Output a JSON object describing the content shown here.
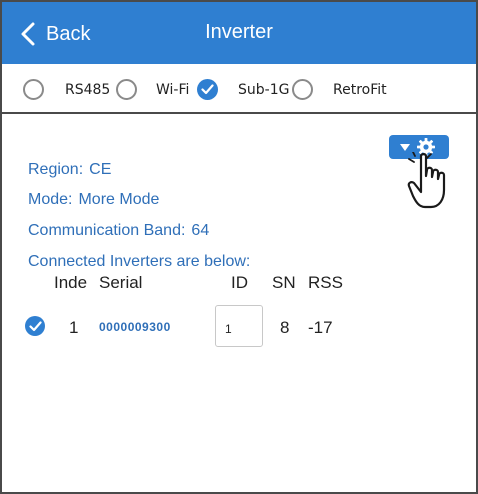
{
  "header": {
    "back_label": "Back",
    "title": "Inverter",
    "color": "#2f7fd1"
  },
  "modes": [
    {
      "label": "RS485",
      "selected": false
    },
    {
      "label": "Wi-Fi",
      "selected": false
    },
    {
      "label": "Sub-1G",
      "selected": true
    },
    {
      "label": "RetroFit",
      "selected": false
    }
  ],
  "info": {
    "region_label": "Region:",
    "region_value": "CE",
    "mode_label": "Mode:",
    "mode_value": "More Mode",
    "band_label": "Communication Band:",
    "band_value": "64",
    "connected_label": "Connected Inverters are below:"
  },
  "table": {
    "headers": [
      "Inde",
      "Serial",
      "ID",
      "SN",
      "RSS"
    ],
    "rows": [
      {
        "checked": true,
        "index": "1",
        "serial": "0000009300",
        "id": "1",
        "sn": "8",
        "rss": "-17"
      }
    ]
  },
  "icons": {
    "back": "chevron-left-icon",
    "settings": "gear-icon",
    "dropdown": "triangle-down-icon",
    "pointer": "hand-pointer-icon",
    "check": "check-icon"
  },
  "accent_color": "#2f7fd1",
  "info_text_color": "#2f6fb8"
}
